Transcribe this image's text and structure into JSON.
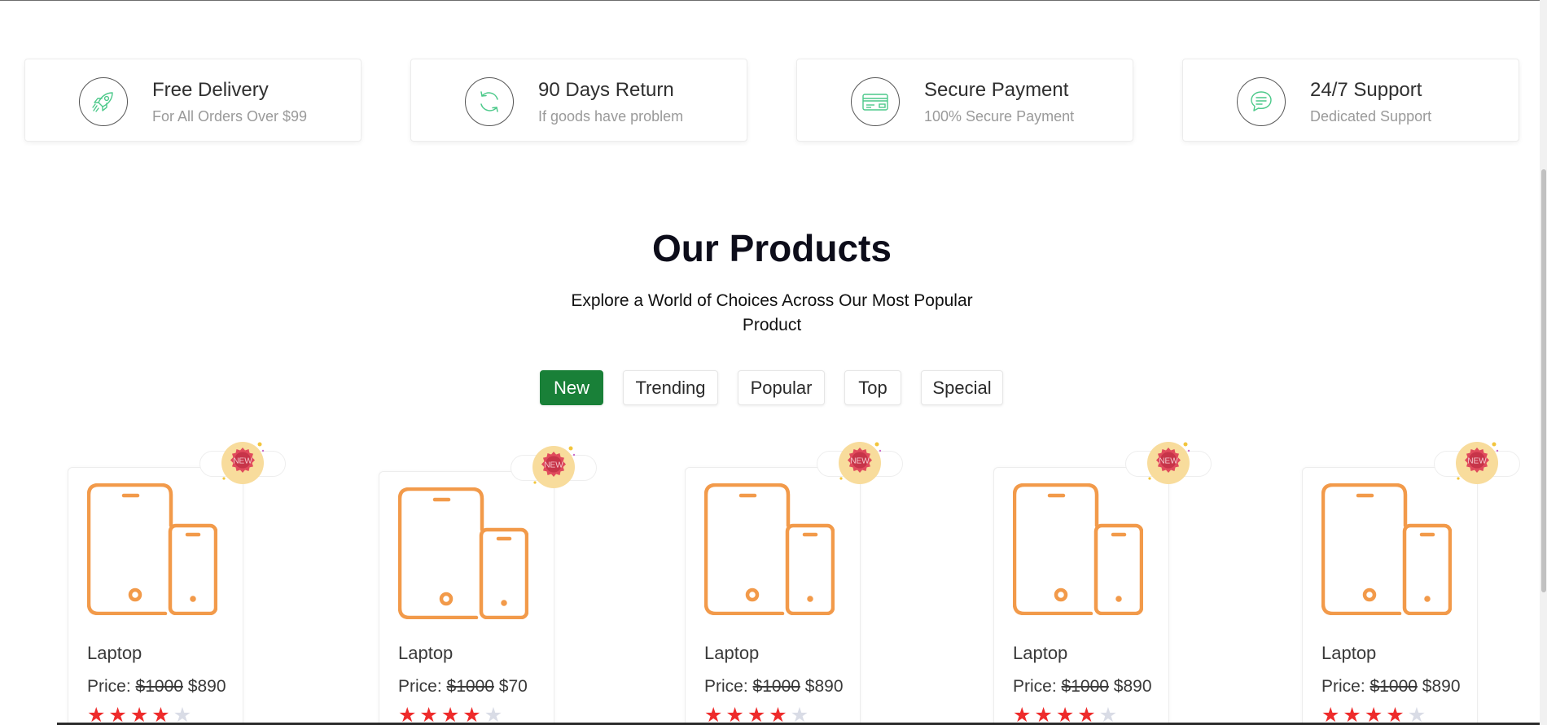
{
  "features": [
    {
      "icon": "rocket-icon",
      "title": "Free Delivery",
      "subtitle": "For All Orders Over $99"
    },
    {
      "icon": "refresh-icon",
      "title": "90 Days Return",
      "subtitle": "If goods have problem"
    },
    {
      "icon": "credit-card-icon",
      "title": "Secure Payment",
      "subtitle": "100% Secure Payment"
    },
    {
      "icon": "chat-icon",
      "title": "24/7 Support",
      "subtitle": "Dedicated Support"
    }
  ],
  "section": {
    "title": "Our Products",
    "subtitle": "Explore a World of Choices Across Our Most Popular Product"
  },
  "tabs": [
    {
      "label": "New",
      "active": true
    },
    {
      "label": "Trending",
      "active": false
    },
    {
      "label": "Popular",
      "active": false
    },
    {
      "label": "Top",
      "active": false
    },
    {
      "label": "Special",
      "active": false
    }
  ],
  "products": [
    {
      "name": "Laptop",
      "price_label": "Price:",
      "old_price": "$1000",
      "price": "$890",
      "rating": 4,
      "rating_max": 5,
      "badge": "NEW",
      "icon": "tablet-phone-icon"
    },
    {
      "name": "Laptop",
      "price_label": "Price:",
      "old_price": "$1000",
      "price": "$70",
      "rating": 4,
      "rating_max": 5,
      "badge": "NEW",
      "icon": "tablet-phone-icon"
    },
    {
      "name": "Laptop",
      "price_label": "Price:",
      "old_price": "$1000",
      "price": "$890",
      "rating": 4,
      "rating_max": 5,
      "badge": "NEW",
      "icon": "tablet-phone-icon"
    },
    {
      "name": "Laptop",
      "price_label": "Price:",
      "old_price": "$1000",
      "price": "$890",
      "rating": 4,
      "rating_max": 5,
      "badge": "NEW",
      "icon": "tablet-phone-icon"
    },
    {
      "name": "Laptop",
      "price_label": "Price:",
      "old_price": "$1000",
      "price": "$890",
      "rating": 4,
      "rating_max": 5,
      "badge": "NEW",
      "icon": "tablet-phone-icon"
    }
  ],
  "colors": {
    "accent": "#198038",
    "feature_icon": "#4cc98a",
    "product_icon": "#f29a4a",
    "star_on": "#ee2b2b",
    "star_off": "#d9dce6",
    "badge": "#e04a5c"
  }
}
